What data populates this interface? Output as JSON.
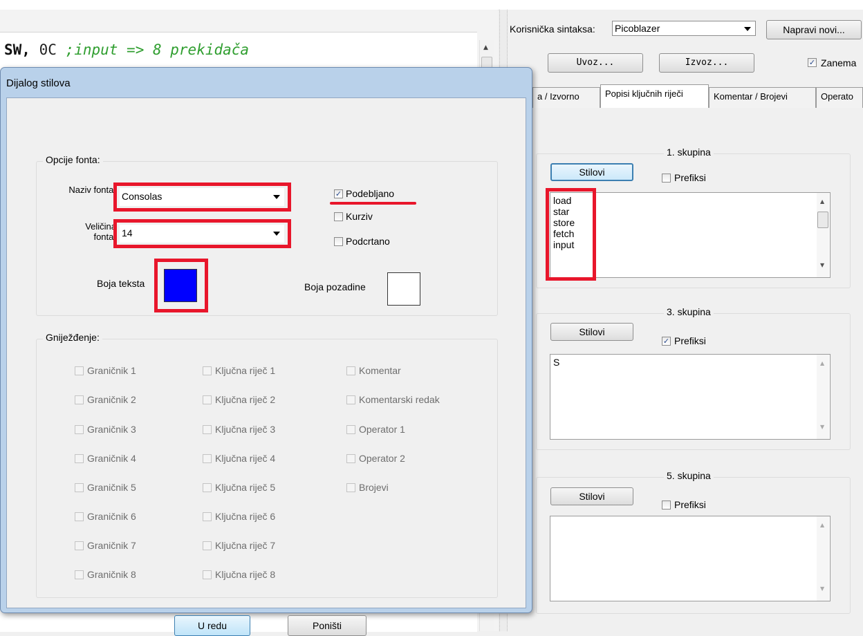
{
  "editor": {
    "code_keyword": "SW,",
    "code_value": "0C",
    "code_comment": ";input => 8 prekidača"
  },
  "syntax_panel": {
    "syntax_label": "Korisnička sintaksa:",
    "syntax_value": "Picoblazer",
    "new_button": "Napravi novi...",
    "import_button": "Uvoz...",
    "export_button": "Izvoz...",
    "ignore_label": "Zanema",
    "ignore_checked": true,
    "tabs": [
      "a / Izvorno",
      "Popisi ključnih riječi",
      "Komentar / Brojevi",
      "Operato"
    ],
    "active_tab": "Popisi ključnih riječi",
    "groups": [
      {
        "title": "1. skupina",
        "styles_button": "Stilovi",
        "prefix_label": "Prefiksi",
        "prefix_checked": false,
        "keywords": [
          "load",
          "star",
          "store",
          "fetch",
          "input"
        ]
      },
      {
        "title": "3. skupina",
        "styles_button": "Stilovi",
        "prefix_label": "Prefiksi",
        "prefix_checked": true,
        "keywords": [
          "S"
        ]
      },
      {
        "title": "5. skupina",
        "styles_button": "Stilovi",
        "prefix_label": "Prefiksi",
        "prefix_checked": false,
        "keywords": []
      }
    ]
  },
  "dialog": {
    "title": "Dijalog stilova",
    "font_options": {
      "group_title": "Opcije fonta:",
      "font_name_label": "Naziv fonta:",
      "font_name_value": "Consolas",
      "font_size_label": "Veličina fonta:",
      "font_size_value": "14",
      "bold_label": "Podebljano",
      "bold_checked": true,
      "italic_label": "Kurziv",
      "italic_checked": false,
      "underline_label": "Podcrtano",
      "underline_checked": false,
      "text_color_label": "Boja teksta",
      "text_color": "#0000ff",
      "bg_color_label": "Boja pozadine",
      "bg_color": "#ffffff"
    },
    "nesting": {
      "group_title": "Gniježđenje:",
      "col1": [
        "Graničnik 1",
        "Graničnik 2",
        "Graničnik 3",
        "Graničnik 4",
        "Graničnik 5",
        "Graničnik 6",
        "Graničnik 7",
        "Graničnik 8"
      ],
      "col2": [
        "Ključna riječ 1",
        "Ključna riječ 2",
        "Ključna riječ 3",
        "Ključna riječ 4",
        "Ključna riječ 5",
        "Ključna riječ 6",
        "Ključna riječ 7",
        "Ključna riječ 8"
      ],
      "col3": [
        "Komentar",
        "Komentarski redak",
        "Operator 1",
        "Operator 2",
        "Brojevi"
      ]
    },
    "ok_button": "U redu",
    "cancel_button": "Poništi"
  },
  "colors": {
    "highlight_red": "#e8162b",
    "comment_green": "#2f9e2f"
  }
}
